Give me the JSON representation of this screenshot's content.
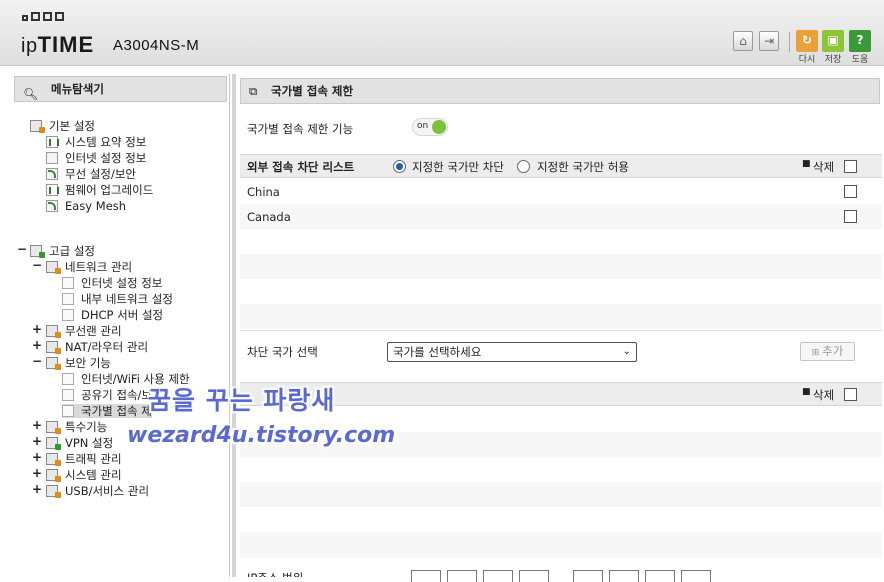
{
  "header": {
    "logo_prefix": "ip",
    "logo_brand": "TIME",
    "model": "A3004NS-M",
    "buttons": [
      {
        "label": "다시",
        "icon": "refresh-icon",
        "color": "#e9a23b"
      },
      {
        "label": "저장",
        "icon": "save-icon",
        "color": "#8cc43a"
      },
      {
        "label": "도움",
        "icon": "help-icon",
        "color": "#3a9a3a"
      }
    ]
  },
  "sidebar": {
    "title": "메뉴탐색기",
    "basic": {
      "label": "기본 설정",
      "items": [
        "시스템 요약 정보",
        "인터넷 설정 정보",
        "무선 설정/보안",
        "펌웨어 업그레이드",
        "Easy Mesh"
      ]
    },
    "advanced": {
      "label": "고급 설정",
      "network": {
        "label": "네트워크 관리",
        "items": [
          "인터넷 설정 정보",
          "내부 네트워크 설정",
          "DHCP 서버 설정"
        ]
      },
      "wireless": "무선랜 관리",
      "nat": "NAT/라우터 관리",
      "security": {
        "label": "보안 기능",
        "items": [
          "인터넷/WiFi 사용 제한",
          "공유기 접속/보",
          "국가별 접속 제"
        ]
      },
      "special": "특수기능",
      "vpn": "VPN 설정",
      "traffic": "트래픽 관리",
      "system": "시스템 관리",
      "usb": "USB/서비스 관리"
    }
  },
  "main": {
    "title": "국가별 접속 제한",
    "feature_label": "국가별 접속 제한 기능",
    "toggle_state": "on",
    "list_title": "외부 접속 차단 리스트",
    "radio_block": "지정한 국가만 차단",
    "radio_allow": "지정한 국가만 허용",
    "delete_label": "삭제",
    "countries": [
      "China",
      "Canada"
    ],
    "select_label": "차단 국가 선택",
    "select_placeholder": "국가를 선택하세요",
    "add_label": "추가",
    "delete_label_2": "삭제",
    "ip_range_label": "IP주소 범위"
  },
  "watermark": {
    "line1": "꿈을 꾸는 파랑새",
    "line2": "wezard4u.tistory.com"
  }
}
